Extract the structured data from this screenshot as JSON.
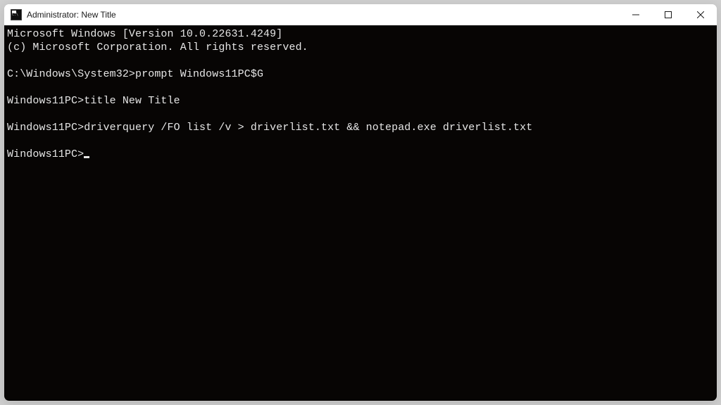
{
  "window": {
    "title": "Administrator:  New Title"
  },
  "terminal": {
    "lines": [
      "Microsoft Windows [Version 10.0.22631.4249]",
      "(c) Microsoft Corporation. All rights reserved.",
      "",
      "C:\\Windows\\System32>prompt Windows11PC$G",
      "",
      "Windows11PC>title New Title",
      "",
      "Windows11PC>driverquery /FO list /v > driverlist.txt && notepad.exe driverlist.txt",
      "",
      "Windows11PC>"
    ],
    "cursor_on_line": 9
  }
}
